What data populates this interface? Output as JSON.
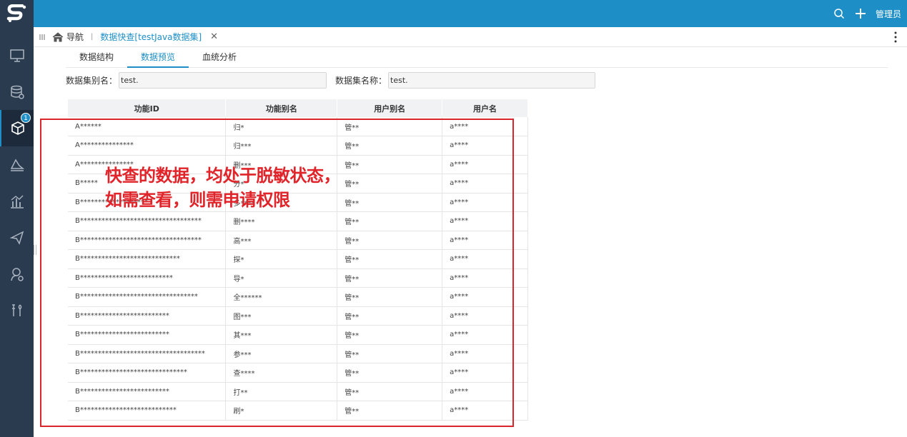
{
  "header": {
    "admin_label": "管理员",
    "accent": "#1e8fc6",
    "sidebar_bg": "#2a3a4f"
  },
  "sidebar": {
    "items": [
      {
        "icon": "monitor-icon"
      },
      {
        "icon": "database-icon"
      },
      {
        "icon": "cube-icon",
        "badge": "1",
        "active": true
      },
      {
        "icon": "layers-icon"
      },
      {
        "icon": "bar-chart-icon"
      },
      {
        "icon": "send-icon"
      },
      {
        "icon": "user-settings-icon"
      },
      {
        "icon": "tools-icon"
      }
    ]
  },
  "tabbar": {
    "home_label": "导航",
    "active_tab": "数据快查[testJava数据集]"
  },
  "subtabs": [
    "数据结构",
    "数据预览",
    "血统分析"
  ],
  "form": {
    "alias_label": "数据集别名：",
    "alias_value": "test.",
    "name_label": "数据集名称：",
    "name_value": "test."
  },
  "table": {
    "columns": [
      "功能ID",
      "功能别名",
      "用户别名",
      "用户名"
    ],
    "rows": [
      [
        "A******",
        "归*",
        "管**",
        "a****"
      ],
      [
        "A***************",
        "归***",
        "管**",
        "a****"
      ],
      [
        "A***************",
        "删***",
        "管**",
        "a****"
      ],
      [
        "B*****",
        "分*",
        "管**",
        "a****"
      ],
      [
        "B*******************",
        "多****",
        "管**",
        "a****"
      ],
      [
        "B**********************************",
        "删****",
        "管**",
        "a****"
      ],
      [
        "B**********************************",
        "高***",
        "管**",
        "a****"
      ],
      [
        "B****************************",
        "探*",
        "管**",
        "a****"
      ],
      [
        "B**************************",
        "导*",
        "管**",
        "a****"
      ],
      [
        "B*********************************",
        "全******",
        "管**",
        "a****"
      ],
      [
        "B*************************",
        "图***",
        "管**",
        "a****"
      ],
      [
        "B*************************",
        "其***",
        "管**",
        "a****"
      ],
      [
        "B***********************************",
        "参***",
        "管**",
        "a****"
      ],
      [
        "B******************************",
        "查****",
        "管**",
        "a****"
      ],
      [
        "B*************************",
        "打**",
        "管**",
        "a****"
      ],
      [
        "B***************************",
        "刷*",
        "管**",
        "a****"
      ]
    ]
  },
  "annotation": {
    "text": "快查的数据，均处于脱敏状态，\n如需查看，则需申请权限",
    "color": "#e0242a"
  }
}
